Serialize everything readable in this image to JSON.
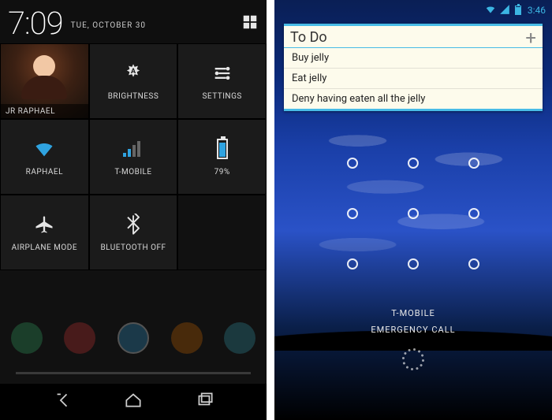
{
  "left": {
    "time": "7:09",
    "date": "TUE, OCTOBER 30",
    "tiles": {
      "user": "JR RAPHAEL",
      "brightness": "BRIGHTNESS",
      "settings": "SETTINGS",
      "wifi": "RAPHAEL",
      "carrier": "T-MOBILE",
      "battery": "79%",
      "airplane": "AIRPLANE MODE",
      "bluetooth": "BLUETOOTH OFF"
    }
  },
  "right": {
    "time": "3:46",
    "widget": {
      "title": "To Do",
      "items": [
        "Buy jelly",
        "Eat jelly",
        "Deny having eaten all the jelly"
      ]
    },
    "carrier": "T-MOBILE",
    "emergency": "EMERGENCY CALL"
  }
}
